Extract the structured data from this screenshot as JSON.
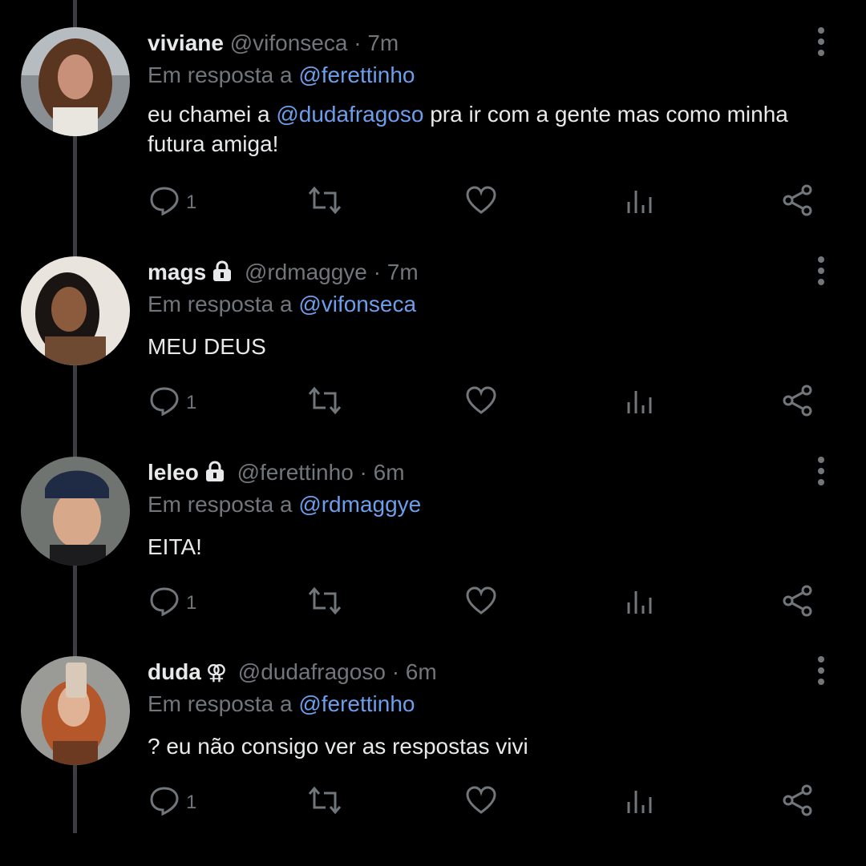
{
  "tweets": [
    {
      "name": "viviane",
      "badge": "",
      "handle": "@vifonseca",
      "dot": "·",
      "time": "7m",
      "reply_prefix": "Em resposta a ",
      "reply_to": "@ferettinho",
      "text_before": "eu chamei a ",
      "text_mention": "@dudafragoso",
      "text_after": " pra ir com a gente mas como minha futura amiga!",
      "reply_count": "1"
    },
    {
      "name": "mags",
      "badge": "lock-icon",
      "handle": "@rdmaggye",
      "dot": "·",
      "time": "7m",
      "reply_prefix": "Em resposta a ",
      "reply_to": "@vifonseca",
      "text_before": "MEU DEUS",
      "text_mention": "",
      "text_after": "",
      "reply_count": "1"
    },
    {
      "name": "leleo",
      "badge": "lock-icon",
      "handle": "@ferettinho",
      "dot": "·",
      "time": "6m",
      "reply_prefix": "Em resposta a ",
      "reply_to": "@rdmaggye",
      "text_before": "EITA!",
      "text_mention": "",
      "text_after": "",
      "reply_count": "1"
    },
    {
      "name": "duda",
      "badge": "double-venus-icon",
      "badge_glyph": "⚢",
      "handle": "@dudafragoso",
      "dot": "·",
      "time": "6m",
      "reply_prefix": "Em resposta a ",
      "reply_to": "@ferettinho",
      "text_before": "? eu não consigo ver as respostas vivi",
      "text_mention": "",
      "text_after": "",
      "reply_count": "1"
    }
  ],
  "colors": {
    "background": "#000000",
    "text": "#e7e9ea",
    "muted": "#71767b",
    "mention": "#6d9eeb",
    "thread_line": "#3b3d40"
  },
  "icons": [
    "comment-icon",
    "retweet-icon",
    "like-icon",
    "views-icon",
    "share-icon",
    "more-icon",
    "lock-icon"
  ]
}
